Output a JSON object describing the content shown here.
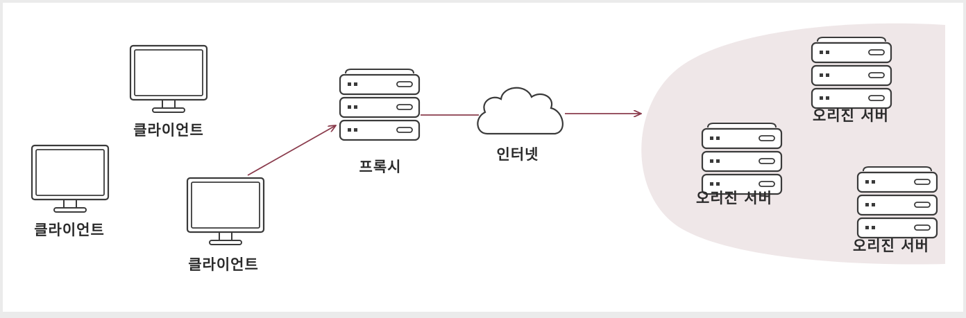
{
  "labels": {
    "client": "클라이언트",
    "proxy": "프록시",
    "internet": "인터넷",
    "origin": "오리진 서버"
  },
  "colors": {
    "background": "#ffffff",
    "frame": "#ebebeb",
    "origin_zone": "#efe7e8",
    "arrow": "#8a3b4c",
    "stroke": "#3a3a3a"
  }
}
